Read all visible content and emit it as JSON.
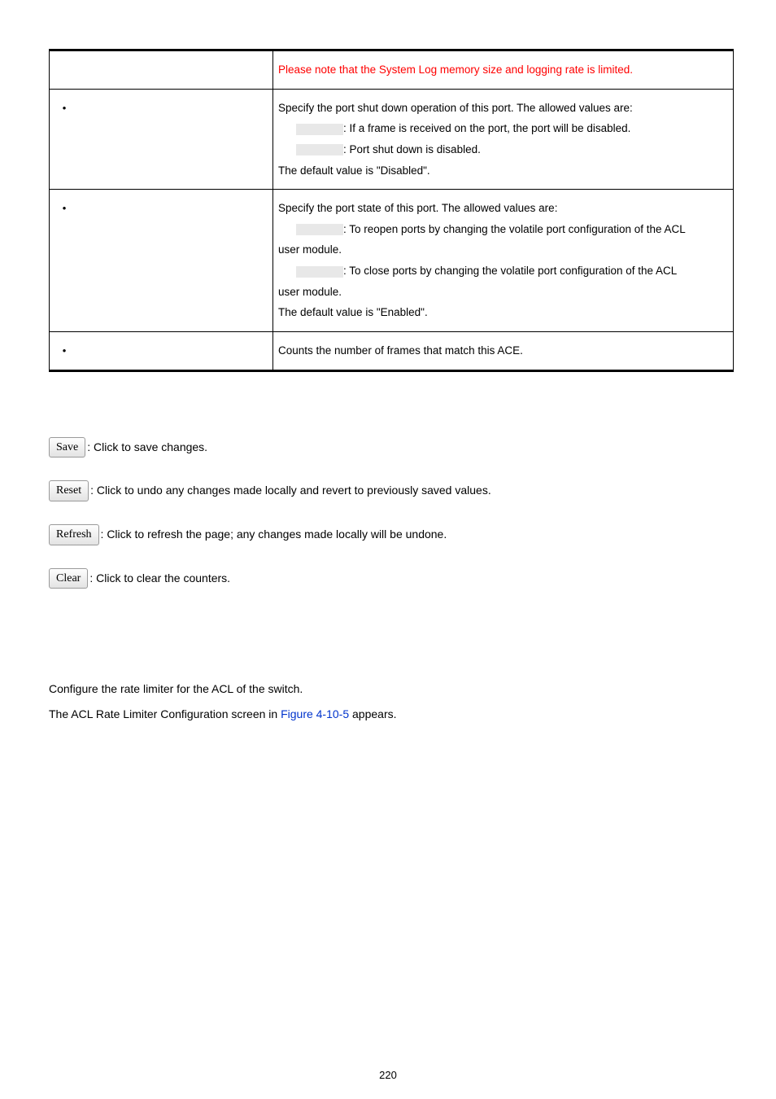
{
  "table": {
    "rows": [
      {
        "bullet": "",
        "html_block": "row0"
      },
      {
        "bullet": "•",
        "html_block": "row1"
      },
      {
        "bullet": "•",
        "html_block": "row2"
      },
      {
        "bullet": "•",
        "html_block": "row3"
      }
    ],
    "row0_line1": "Please note that the System Log memory size and logging rate is limited.",
    "row1_line1": "Specify the port shut down operation of this port. The allowed values are:",
    "row1_line2": ": If a frame is received on the port, the port will be disabled.",
    "row1_line3": ": Port shut down is disabled.",
    "row1_line4": "The default value is \"Disabled\".",
    "row2_line1": "Specify the port state of this port. The allowed values are:",
    "row2_line2": ": To reopen ports by changing the volatile port configuration of the ACL",
    "row2_line3": "user module.",
    "row2_line4": ": To close ports by changing the volatile port configuration of the ACL",
    "row2_line5": "user module.",
    "row2_line6": "The default value is \"Enabled\".",
    "row3_line1": "Counts the number of frames that match this ACE."
  },
  "buttons": {
    "save_label": "Save",
    "save_desc": ": Click to save changes.",
    "reset_label": "Reset",
    "reset_desc": ": Click to undo any changes made locally and revert to previously saved values.",
    "refresh_label": "Refresh",
    "refresh_desc": ": Click to refresh the page; any changes made locally will be undone.",
    "clear_label": "Clear",
    "clear_desc": ": Click to clear the counters."
  },
  "paragraphs": {
    "p1": "Configure the rate limiter for the ACL of the switch.",
    "p2_prefix": "The ACL Rate Limiter Configuration screen in ",
    "p2_link": "Figure 4-10-5",
    "p2_suffix": " appears."
  },
  "page_number": "220"
}
